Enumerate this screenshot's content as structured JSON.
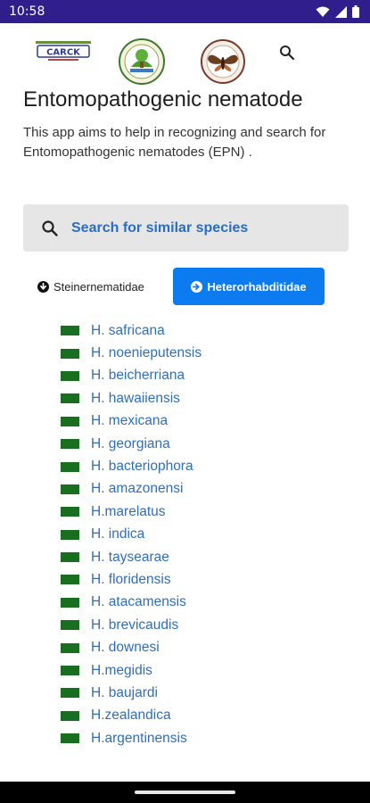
{
  "status_bar": {
    "time": "10:58"
  },
  "header": {
    "logo1_text": "CARCK",
    "logos": [
      "carck-logo",
      "green-seal-logo",
      "moth-seal-logo"
    ]
  },
  "page": {
    "title": "Entomopathogenic nematode",
    "description": "This app aims to help in recognizing and search for Entomopathogenic nematodes (EPN) ."
  },
  "search": {
    "label": "Search for similar species"
  },
  "tabs": {
    "steinernematidae": "Steinernematidae",
    "heterorhabditidae": "Heterorhabditidae"
  },
  "species": [
    "H. safricana",
    "H. noenieputensis",
    "H. beicherriana",
    "H. hawaiiensis",
    "H. mexicana",
    "H. georgiana",
    "H. bacteriophora",
    "H. amazonensi",
    "H.marelatus",
    "H. indica",
    "H. taysearae",
    "H. floridensis",
    "H. atacamensis",
    "H. brevicaudis",
    "H. downesi",
    "H.megidis",
    "H. baujardi",
    "H.zealandica",
    "H.argentinensis"
  ],
  "colors": {
    "status_bar": "#2f1e8c",
    "accent_button": "#0d7bf0",
    "link": "#2f6fb8",
    "flag": "#1a6e1f",
    "search_bg": "#e6e6e6"
  }
}
